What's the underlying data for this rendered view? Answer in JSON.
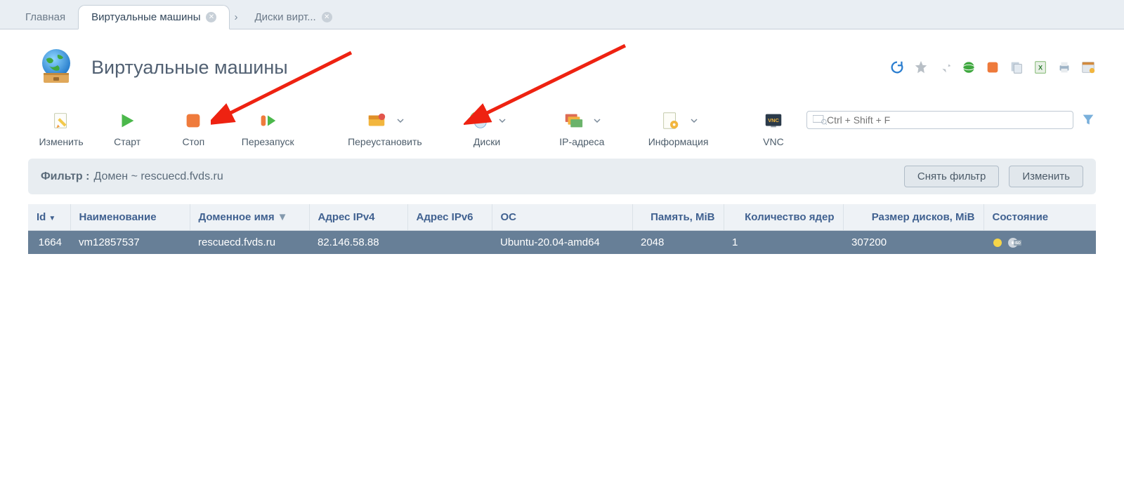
{
  "tabs": {
    "home": "Главная",
    "vm": "Виртуальные машины",
    "disks": "Диски вирт..."
  },
  "page": {
    "title": "Виртуальные машины"
  },
  "toolbar": {
    "edit": "Изменить",
    "start": "Старт",
    "stop": "Стоп",
    "restart": "Перезапуск",
    "reinstall": "Переустановить",
    "disks": "Диски",
    "ip": "IP-адреса",
    "info": "Информация",
    "vnc": "VNC"
  },
  "search": {
    "placeholder": "Ctrl + Shift + F"
  },
  "filter": {
    "label": "Фильтр :",
    "text": "Домен ~ rescuecd.fvds.ru",
    "clear": "Снять фильтр",
    "edit": "Изменить"
  },
  "table": {
    "headers": {
      "id": "Id",
      "name": "Наименование",
      "domain": "Доменное имя",
      "ipv4": "Адрес IPv4",
      "ipv6": "Адрес IPv6",
      "os": "ОС",
      "memory": "Память, MiB",
      "cores": "Количество ядер",
      "disks_size": "Размер дисков, MiB",
      "state": "Состояние"
    },
    "rows": [
      {
        "id": "1664",
        "name": "vm12857537",
        "domain": "rescuecd.fvds.ru",
        "ipv4": "82.146.58.88",
        "ipv6": "",
        "os": "Ubuntu-20.04-amd64",
        "memory": "2048",
        "cores": "1",
        "disks_size": "307200"
      }
    ]
  }
}
